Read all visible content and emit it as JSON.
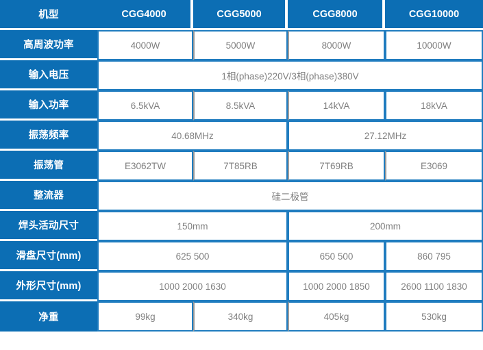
{
  "table": {
    "header": {
      "label": "机型",
      "models": [
        "CGG4000",
        "CGG5000",
        "CGG8000",
        "CGG10000"
      ]
    },
    "rows": [
      {
        "label": "高周波功率",
        "cells": [
          {
            "text": "4000W",
            "span": 1
          },
          {
            "text": "5000W",
            "span": 1
          },
          {
            "text": "8000W",
            "span": 1
          },
          {
            "text": "10000W",
            "span": 1
          }
        ]
      },
      {
        "label": "输入电压",
        "cells": [
          {
            "text": "1相(phase)220V/3相(phase)380V",
            "span": 4
          }
        ]
      },
      {
        "label": "输入功率",
        "cells": [
          {
            "text": "6.5kVA",
            "span": 1
          },
          {
            "text": "8.5kVA",
            "span": 1
          },
          {
            "text": "14kVA",
            "span": 1
          },
          {
            "text": "18kVA",
            "span": 1
          }
        ]
      },
      {
        "label": "振荡频率",
        "cells": [
          {
            "text": "40.68MHz",
            "span": 2
          },
          {
            "text": "27.12MHz",
            "span": 2
          }
        ]
      },
      {
        "label": "振荡管",
        "cells": [
          {
            "text": "E3062TW",
            "span": 1
          },
          {
            "text": "7T85RB",
            "span": 1
          },
          {
            "text": "7T69RB",
            "span": 1
          },
          {
            "text": "E3069",
            "span": 1
          }
        ]
      },
      {
        "label": "整流器",
        "cells": [
          {
            "text": "硅二极管",
            "span": 4
          }
        ]
      },
      {
        "label": "焊头活动尺寸",
        "cells": [
          {
            "text": "150mm",
            "span": 2
          },
          {
            "text": "200mm",
            "span": 2
          }
        ]
      },
      {
        "label": "滑盘尺寸(mm)",
        "cells": [
          {
            "text": "625 500",
            "span": 2
          },
          {
            "text": "650 500",
            "span": 1
          },
          {
            "text": "860 795",
            "span": 1
          }
        ]
      },
      {
        "label": "外形尺寸(mm)",
        "cells": [
          {
            "text": "1000 2000 1630",
            "span": 2
          },
          {
            "text": "1000 2000 1850",
            "span": 1
          },
          {
            "text": "2600 1100 1830",
            "span": 1
          }
        ]
      },
      {
        "label": "净重",
        "cells": [
          {
            "text": "99kg",
            "span": 1
          },
          {
            "text": "340kg",
            "span": 1
          },
          {
            "text": "405kg",
            "span": 1
          },
          {
            "text": "530kg",
            "span": 1
          }
        ]
      }
    ]
  },
  "colors": {
    "header_blue": "#0c6eb4",
    "cell_border_blue": "#1f7cbf",
    "cell_border_grey": "#9a9a9a",
    "body_text_grey": "#808080",
    "header_text": "#ffffff"
  }
}
